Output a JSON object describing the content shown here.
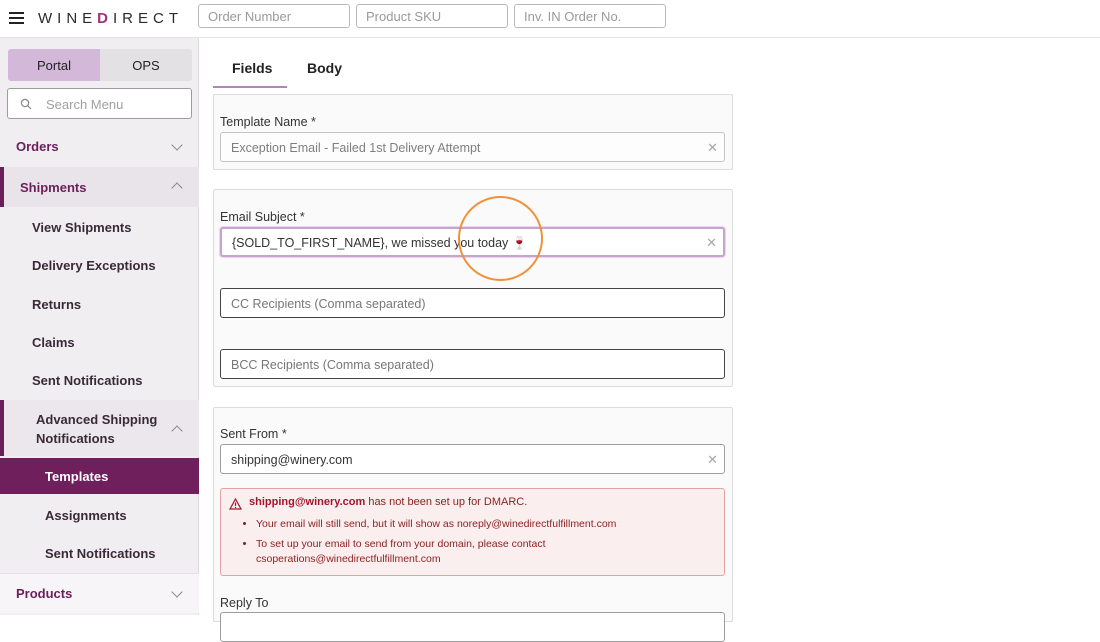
{
  "app": {
    "logo_text": "WINEDIRECT"
  },
  "top_search": {
    "order_number_placeholder": "Order Number",
    "sku_placeholder": "Product SKU",
    "inv_placeholder": "Inv. IN Order No."
  },
  "sidebar": {
    "toggle": [
      "Portal",
      "OPS"
    ],
    "search_placeholder": "Search Menu",
    "orders": "Orders",
    "shipments": "Shipments",
    "shipments_items": [
      "View Shipments",
      "Delivery Exceptions",
      "Returns",
      "Claims",
      "Sent Notifications"
    ],
    "asn_label_line1": "Advanced Shipping",
    "asn_label_line2": "Notifications",
    "asn_items": [
      "Templates",
      "Assignments",
      "Sent Notifications"
    ],
    "products": "Products"
  },
  "tabs": [
    "Fields",
    "Body"
  ],
  "form": {
    "template_name_label": "Template Name *",
    "template_name_value": "Exception Email - Failed 1st Delivery Attempt",
    "email_subject_label": "Email Subject *",
    "email_subject_value": "{SOLD_TO_FIRST_NAME}, we missed you today 🍷",
    "cc_placeholder": "CC Recipients (Comma separated)",
    "bcc_placeholder": "BCC Recipients (Comma separated)",
    "sent_from_label": "Sent From *",
    "sent_from_value": "shipping@winery.com",
    "reply_to_label": "Reply To"
  },
  "alert": {
    "email": "shipping@winery.com",
    "message": " has not been set up for DMARC.",
    "bullets": [
      "Your email will still send, but it will show as noreply@winedirectfulfillment.com",
      "To set up your email to send from your domain, please contact csoperations@winedirectfulfillment.com"
    ]
  },
  "colors": {
    "brand": "#6e1f5c",
    "toggle_active": "#d3b8d9",
    "alert_bg": "#fbeeee",
    "alert_text": "#8c1f1f",
    "cursor_ring": "#f0913a"
  }
}
